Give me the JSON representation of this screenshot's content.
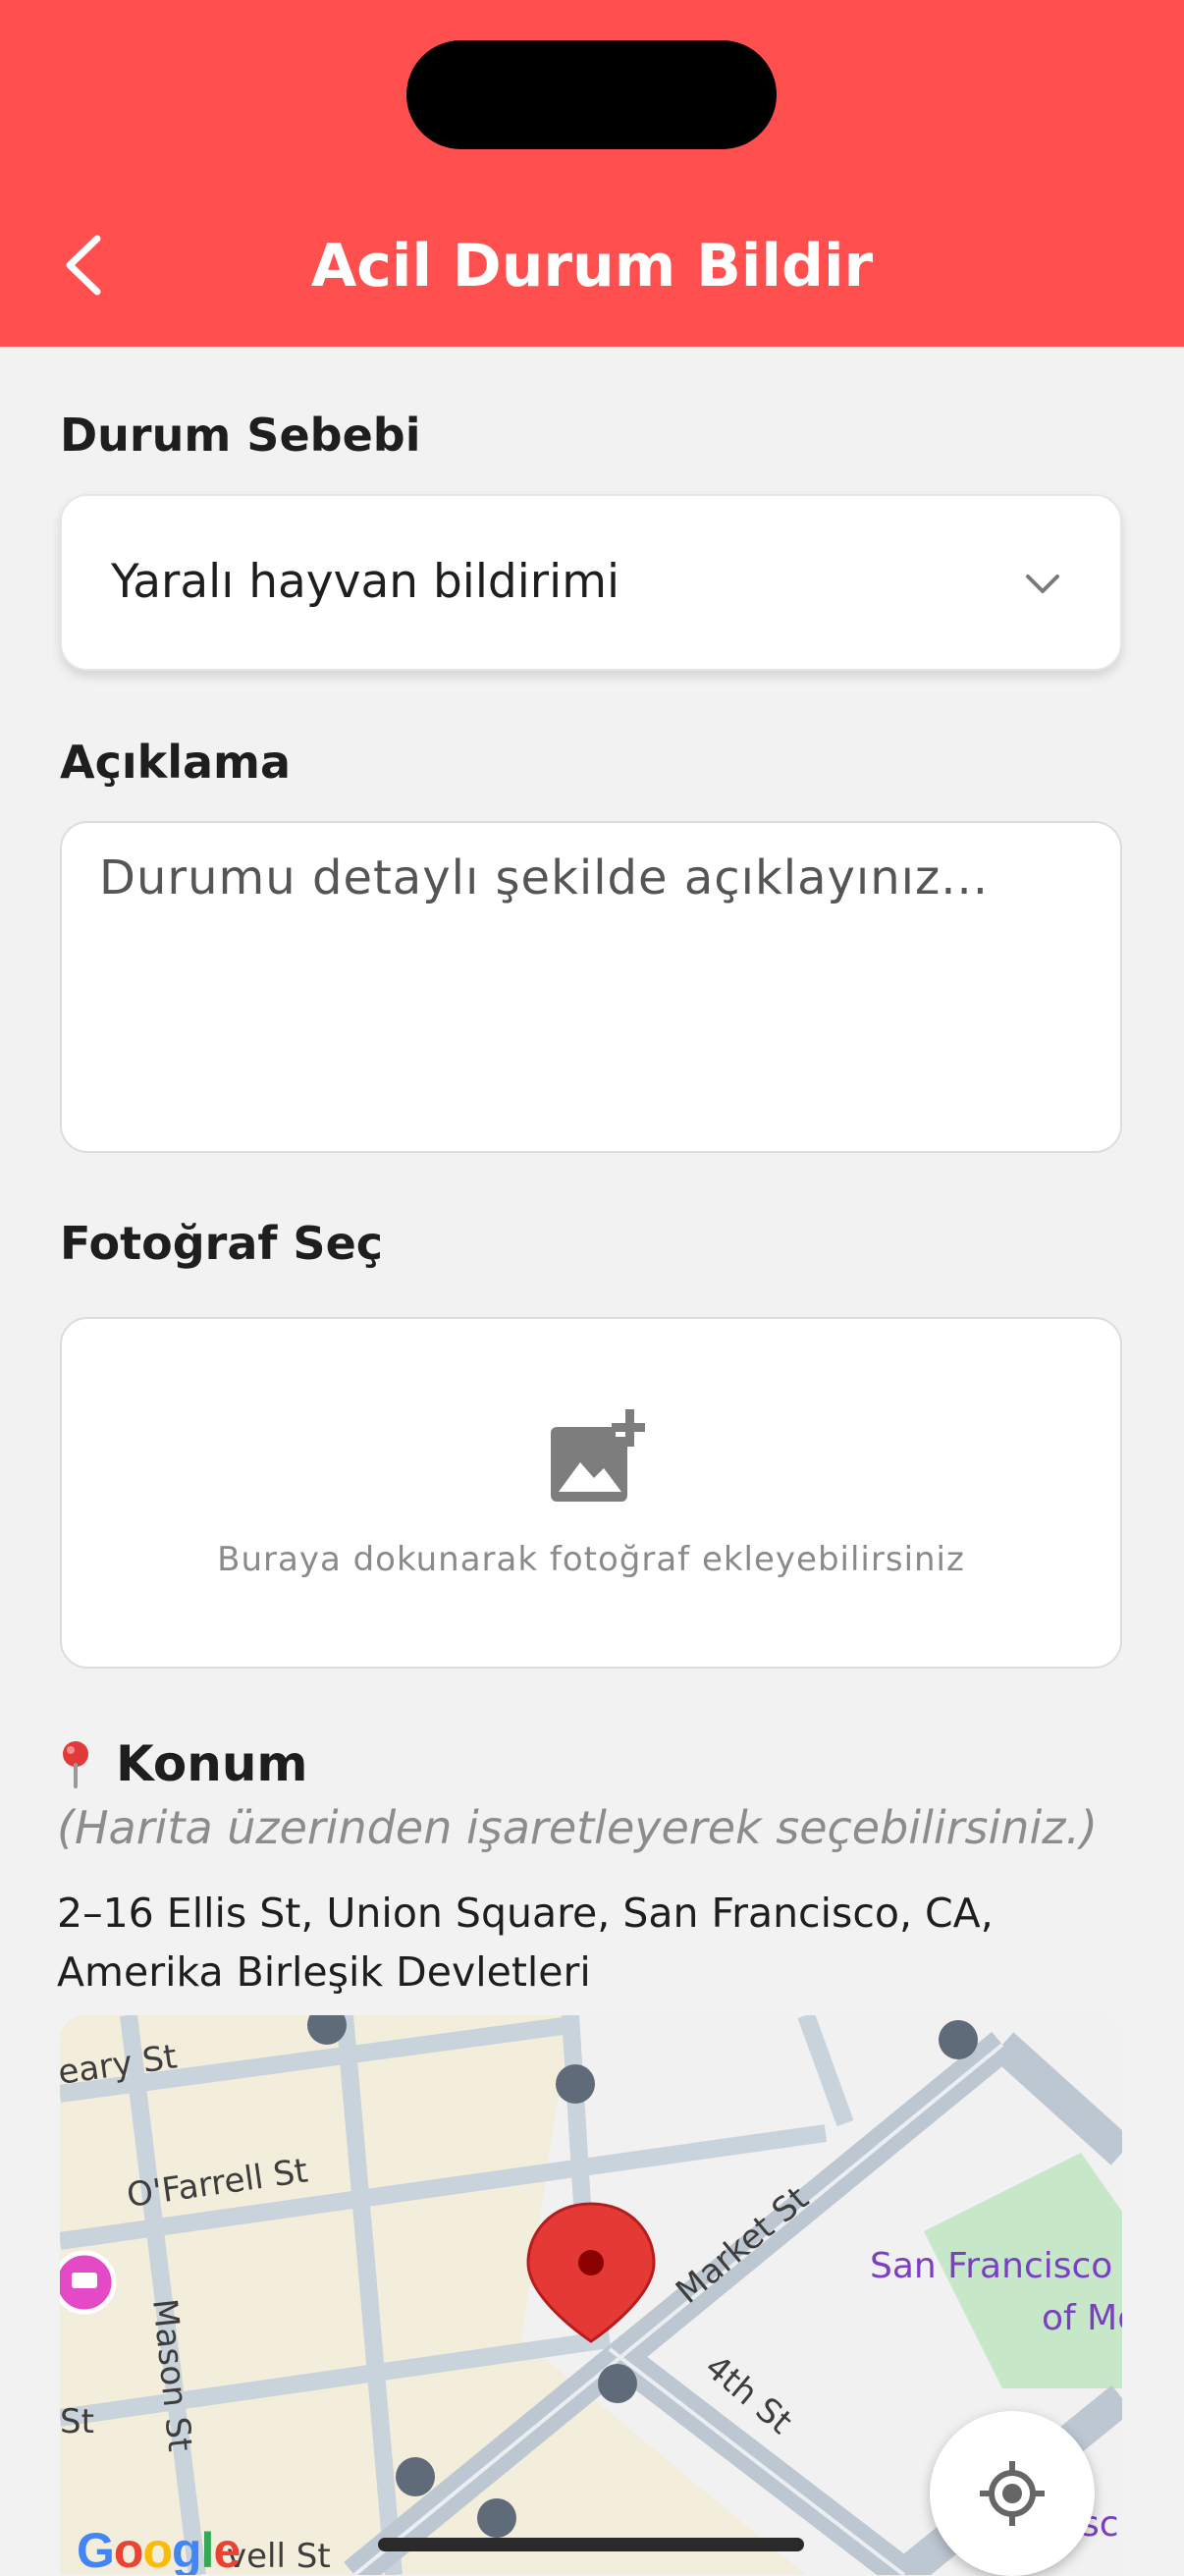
{
  "header": {
    "title": "Acil Durum Bildir",
    "background_color": "#ff4f4f"
  },
  "reason": {
    "label": "Durum Sebebi",
    "selected_value": "Yaralı hayvan bildirimi"
  },
  "description": {
    "label": "Açıklama",
    "placeholder": "Durumu detaylı şekilde açıklayınız..."
  },
  "photo": {
    "label": "Fotoğraf Seç",
    "hint": "Buraya dokunarak fotoğraf ekleyebilirsiniz"
  },
  "location": {
    "title": "Konum",
    "hint": "(Harita üzerinden işaretleyerek seçebilirsiniz.)",
    "address": "2–16 Ellis St, Union Square, San Francisco, CA, Amerika Birleşik Devletleri"
  },
  "map": {
    "street_labels": [
      "eary St",
      "O'Farrell St",
      "Mason St",
      "Market St",
      "4th St",
      "St",
      "vell St"
    ],
    "poi_label_line1": "San Francisco",
    "poi_label_line2": "of Mo",
    "poi_label_partial": "sc",
    "attribution": "Google"
  }
}
